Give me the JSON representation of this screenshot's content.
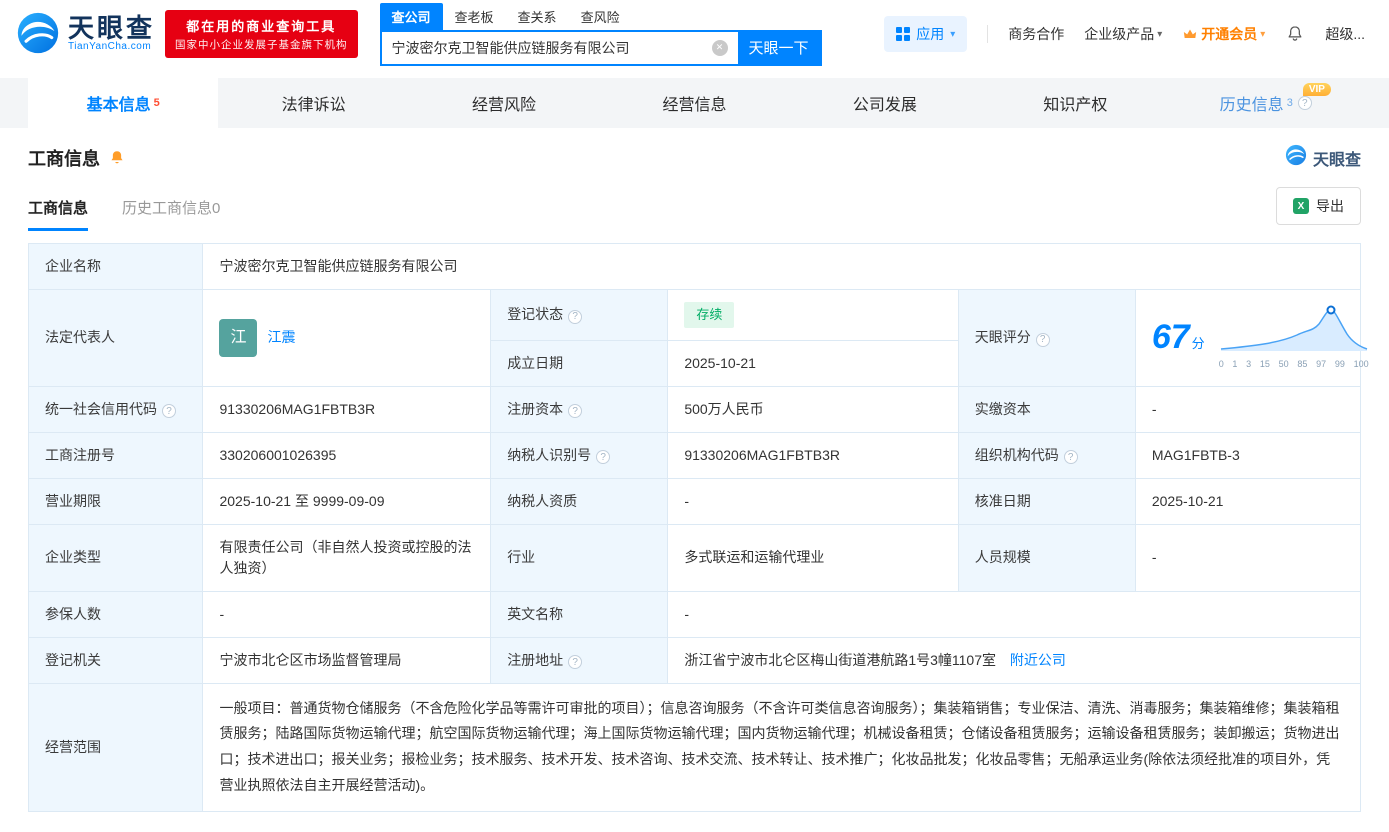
{
  "colors": {
    "accent": "#0084ff",
    "promo_red": "#e60012",
    "member_orange": "#ff8000",
    "status_green": "#00ad65",
    "vip_gold": "#ffb62c",
    "avatar_teal": "#55a39e"
  },
  "icons": {
    "caret": "▾",
    "help": "?",
    "clear": "✕",
    "excel": "X"
  },
  "header": {
    "logo_title": "天眼查",
    "logo_subtitle": "TianYanCha.com",
    "promo_badge": {
      "line1": "都在用的商业查询工具",
      "line2": "国家中小企业发展子基金旗下机构"
    },
    "search": {
      "tabs": [
        {
          "label": "查公司",
          "active": true
        },
        {
          "label": "查老板",
          "active": false
        },
        {
          "label": "查关系",
          "active": false
        },
        {
          "label": "查风险",
          "active": false
        }
      ],
      "value": "宁波密尔克卫智能供应链服务有限公司",
      "button": "天眼一下"
    },
    "apps_label": "应用",
    "links": {
      "cooperation": "商务合作",
      "enterprise": "企业级产品",
      "membership": "开通会员",
      "super": "超级..."
    }
  },
  "tabs": [
    {
      "label": "基本信息",
      "sup": "5",
      "active": true
    },
    {
      "label": "法律诉讼"
    },
    {
      "label": "经营风险"
    },
    {
      "label": "经营信息"
    },
    {
      "label": "公司发展"
    },
    {
      "label": "知识产权"
    },
    {
      "label": "历史信息",
      "sup": "3",
      "vip": "VIP"
    }
  ],
  "section": {
    "title": "工商信息",
    "watermark": "天眼查",
    "tabs": [
      {
        "label": "工商信息",
        "active": true
      },
      {
        "label": "历史工商信息0",
        "active": false
      }
    ],
    "export_label": "导出"
  },
  "info": {
    "company_name": {
      "label": "企业名称",
      "value": "宁波密尔克卫智能供应链服务有限公司"
    },
    "legal_rep": {
      "label": "法定代表人",
      "avatar": "江",
      "name": "江震"
    },
    "reg_status": {
      "label": "登记状态",
      "value": "存续"
    },
    "establish_date": {
      "label": "成立日期",
      "value": "2025-10-21"
    },
    "score": {
      "label": "天眼评分",
      "value": "67",
      "unit": "分",
      "axis": [
        "0",
        "1",
        "3",
        "15",
        "50",
        "85",
        "97",
        "99",
        "100"
      ]
    },
    "credit_code": {
      "label": "统一社会信用代码",
      "value": "91330206MAG1FBTB3R"
    },
    "reg_capital": {
      "label": "注册资本",
      "value": "500万人民币"
    },
    "paid_capital": {
      "label": "实缴资本",
      "value": "-"
    },
    "reg_number": {
      "label": "工商注册号",
      "value": "330206001026395"
    },
    "taxpayer_id": {
      "label": "纳税人识别号",
      "value": "91330206MAG1FBTB3R"
    },
    "org_code": {
      "label": "组织机构代码",
      "value": "MAG1FBTB-3"
    },
    "business_term": {
      "label": "营业期限",
      "value": "2025-10-21 至 9999-09-09"
    },
    "taxpayer_quality": {
      "label": "纳税人资质",
      "value": "-"
    },
    "approval_date": {
      "label": "核准日期",
      "value": "2025-10-21"
    },
    "company_type": {
      "label": "企业类型",
      "value": "有限责任公司（非自然人投资或控股的法人独资）"
    },
    "industry": {
      "label": "行业",
      "value": "多式联运和运输代理业"
    },
    "staff_size": {
      "label": "人员规模",
      "value": "-"
    },
    "insured_count": {
      "label": "参保人数",
      "value": "-"
    },
    "english_name": {
      "label": "英文名称",
      "value": "-"
    },
    "reg_authority": {
      "label": "登记机关",
      "value": "宁波市北仑区市场监督管理局"
    },
    "reg_address": {
      "label": "注册地址",
      "value": "浙江省宁波市北仑区梅山街道港航路1号3幢1107室",
      "nearby_link": "附近公司"
    },
    "business_scope": {
      "label": "经营范围",
      "value": "一般项目：普通货物仓储服务（不含危险化学品等需许可审批的项目）；信息咨询服务（不含许可类信息咨询服务）；集装箱销售；专业保洁、清洗、消毒服务；集装箱维修；集装箱租赁服务；陆路国际货物运输代理；航空国际货物运输代理；海上国际货物运输代理；国内货物运输代理；机械设备租赁；仓储设备租赁服务；运输设备租赁服务；装卸搬运；货物进出口；技术进出口；报关业务；报检业务；技术服务、技术开发、技术咨询、技术交流、技术转让、技术推广；化妆品批发；化妆品零售；无船承运业务(除依法须经批准的项目外，凭营业执照依法自主开展经营活动)。"
    }
  }
}
